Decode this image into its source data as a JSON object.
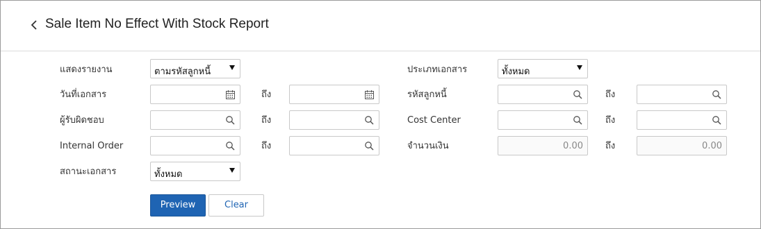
{
  "header": {
    "title": "Sale Item No Effect With Stock Report"
  },
  "form": {
    "report_by": {
      "label": "แสดงรายงาน",
      "value": "ตามรหัสลูกหนี้"
    },
    "doc_type": {
      "label": "ประเภทเอกสาร",
      "value": "ทั้งหมด"
    },
    "doc_date": {
      "label": "วันที่เอกสาร",
      "to": "ถึง"
    },
    "debtor_code": {
      "label": "รหัสลูกหนี้",
      "to": "ถึง"
    },
    "responsible": {
      "label": "ผู้รับผิดชอบ",
      "to": "ถึง"
    },
    "cost_center": {
      "label": "Cost Center",
      "to": "ถึง"
    },
    "internal_order": {
      "label": "Internal Order",
      "to": "ถึง"
    },
    "amount": {
      "label": "จำนวนเงิน",
      "to": "ถึง",
      "from_value": "0.00",
      "to_value": "0.00"
    },
    "doc_status": {
      "label": "สถานะเอกสาร",
      "value": "ทั้งหมด"
    }
  },
  "buttons": {
    "preview": "Preview",
    "clear": "Clear"
  },
  "colors": {
    "primary": "#1f64b3",
    "border": "#c8c8c8"
  }
}
